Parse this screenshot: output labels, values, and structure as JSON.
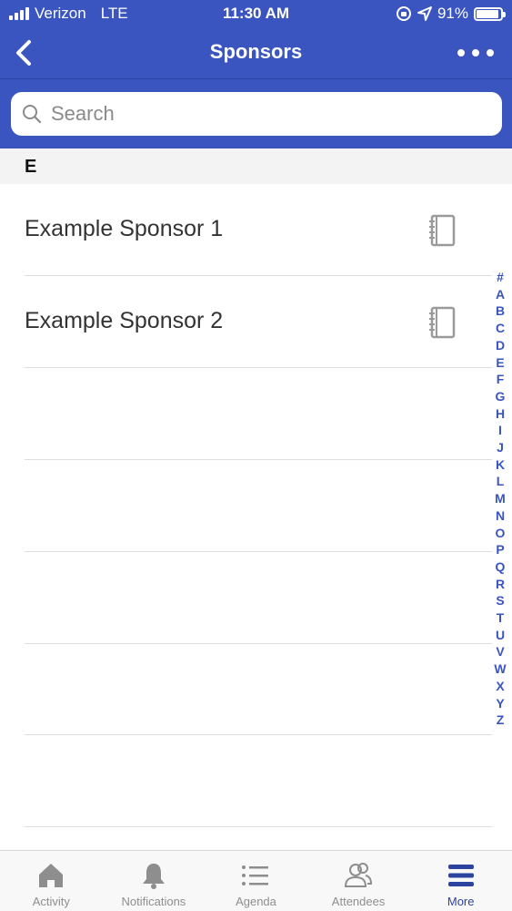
{
  "status_bar": {
    "carrier": "Verizon",
    "network": "LTE",
    "time": "11:30 AM",
    "battery": "91%",
    "battery_level": 0.91
  },
  "nav": {
    "title": "Sponsors",
    "back_icon": "chevron-left-icon",
    "more_icon": "ellipsis-icon"
  },
  "search": {
    "placeholder": "Search",
    "value": ""
  },
  "section": {
    "letter": "E"
  },
  "sponsors": [
    {
      "name": "Example Sponsor 1",
      "icon": "notebook-icon"
    },
    {
      "name": "Example Sponsor 2",
      "icon": "notebook-icon"
    }
  ],
  "index_letters": [
    "#",
    "A",
    "B",
    "C",
    "D",
    "E",
    "F",
    "G",
    "H",
    "I",
    "J",
    "K",
    "L",
    "M",
    "N",
    "O",
    "P",
    "Q",
    "R",
    "S",
    "T",
    "U",
    "V",
    "W",
    "X",
    "Y",
    "Z"
  ],
  "tabs": [
    {
      "label": "Activity",
      "icon": "home-icon",
      "active": false
    },
    {
      "label": "Notifications",
      "icon": "bell-icon",
      "active": false
    },
    {
      "label": "Agenda",
      "icon": "list-icon",
      "active": false
    },
    {
      "label": "Attendees",
      "icon": "people-icon",
      "active": false
    },
    {
      "label": "More",
      "icon": "menu-icon",
      "active": true
    }
  ],
  "colors": {
    "brand": "#3a55bf",
    "tab_inactive": "#8e8e8e",
    "tab_active": "#2c449f"
  }
}
